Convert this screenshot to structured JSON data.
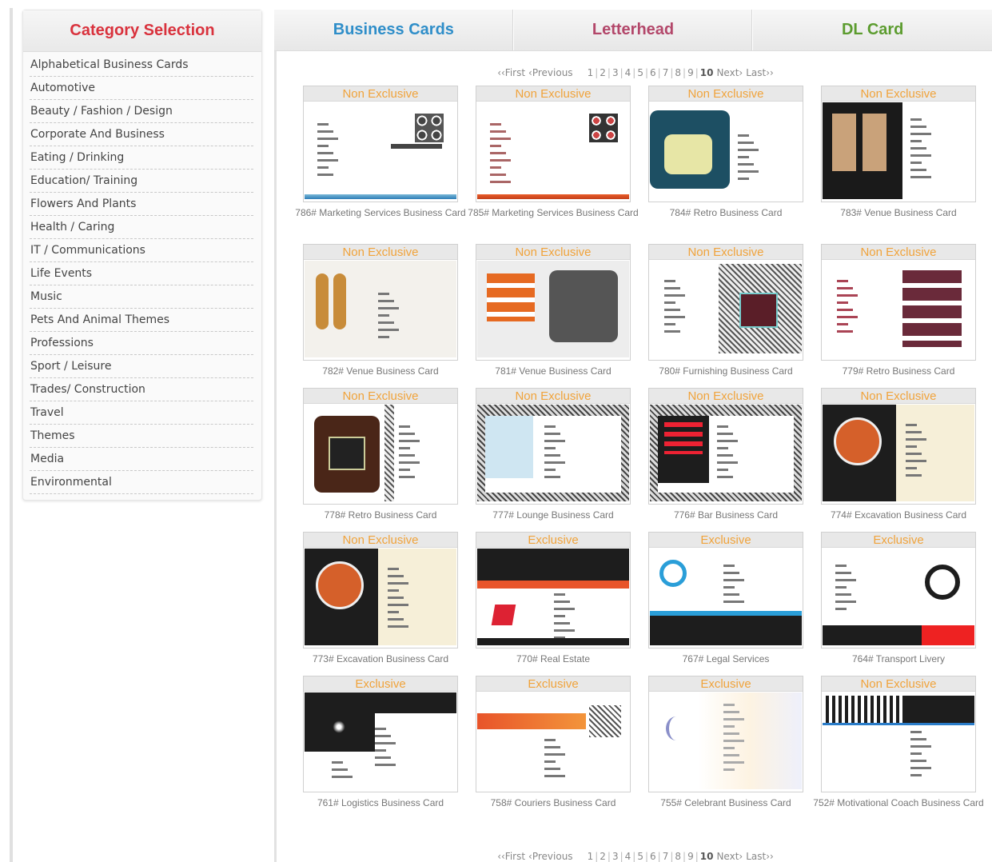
{
  "sidebar": {
    "title": "Category Selection",
    "categories": [
      "Alphabetical Business Cards",
      "Automotive",
      "Beauty / Fashion / Design",
      "Corporate And Business",
      "Eating / Drinking",
      "Education/ Training",
      "Flowers And Plants",
      "Health / Caring",
      "IT / Communications",
      "Life Events",
      "Music",
      "Pets And Animal Themes",
      "Professions",
      "Sport / Leisure",
      "Trades/ Construction",
      "Travel",
      "Themes",
      "Media",
      "Environmental"
    ]
  },
  "tabs": [
    {
      "label": "Business Cards",
      "color": "#2f8ec9"
    },
    {
      "label": "Letterhead",
      "color": "#b3476a"
    },
    {
      "label": "DL Card",
      "color": "#5c9c2f"
    }
  ],
  "pagination": {
    "first": "‹‹First",
    "previous": "‹Previous",
    "pages": [
      "1",
      "2",
      "3",
      "4",
      "5",
      "6",
      "7",
      "8",
      "9",
      "10"
    ],
    "current": "10",
    "next": "Next›",
    "last": "Last››"
  },
  "products": [
    {
      "badge": "Non Exclusive",
      "caption": "786# Marketing Services Business Card",
      "style": "a"
    },
    {
      "badge": "Non Exclusive",
      "caption": "785# Marketing Services Business Card",
      "style": "b"
    },
    {
      "badge": "Non Exclusive",
      "caption": "784# Retro Business Card",
      "style": "retro-teal"
    },
    {
      "badge": "Non Exclusive",
      "caption": "783# Venue Business Card",
      "style": "venue-dark"
    },
    {
      "badge": "Non Exclusive",
      "caption": "782# Venue Business Card",
      "style": "venue-light"
    },
    {
      "badge": "Non Exclusive",
      "caption": "781# Venue Business Card",
      "style": "venue-orange"
    },
    {
      "badge": "Non Exclusive",
      "caption": "780# Furnishing Business Card",
      "style": "pattern"
    },
    {
      "badge": "Non Exclusive",
      "caption": "779# Retro Business Card",
      "style": "retro-pink"
    },
    {
      "badge": "Non Exclusive",
      "caption": "778# Retro Business Card",
      "style": "retro-brown"
    },
    {
      "badge": "Non Exclusive",
      "caption": "777# Lounge Business Card",
      "style": "lounge"
    },
    {
      "badge": "Non Exclusive",
      "caption": "776# Bar Business Card",
      "style": "bar"
    },
    {
      "badge": "Non Exclusive",
      "caption": "774# Excavation Business Card",
      "style": "excavation"
    },
    {
      "badge": "Non Exclusive",
      "caption": "773# Excavation Business Card",
      "style": "excavation2"
    },
    {
      "badge": "Exclusive",
      "caption": "770# Real Estate",
      "style": "realestate"
    },
    {
      "badge": "Exclusive",
      "caption": "767# Legal Services",
      "style": "legal"
    },
    {
      "badge": "Exclusive",
      "caption": "764# Transport Livery",
      "style": "transport"
    },
    {
      "badge": "Exclusive",
      "caption": "761# Logistics Business Card",
      "style": "logistics"
    },
    {
      "badge": "Exclusive",
      "caption": "758# Couriers Business Card",
      "style": "couriers"
    },
    {
      "badge": "Exclusive",
      "caption": "755# Celebrant Business Card",
      "style": "celebrant"
    },
    {
      "badge": "Non Exclusive",
      "caption": "752# Motivational Coach Business Card",
      "style": "coach"
    }
  ],
  "colors": {
    "badge": "#f0a33b",
    "sidebar_title": "#d9323d"
  }
}
